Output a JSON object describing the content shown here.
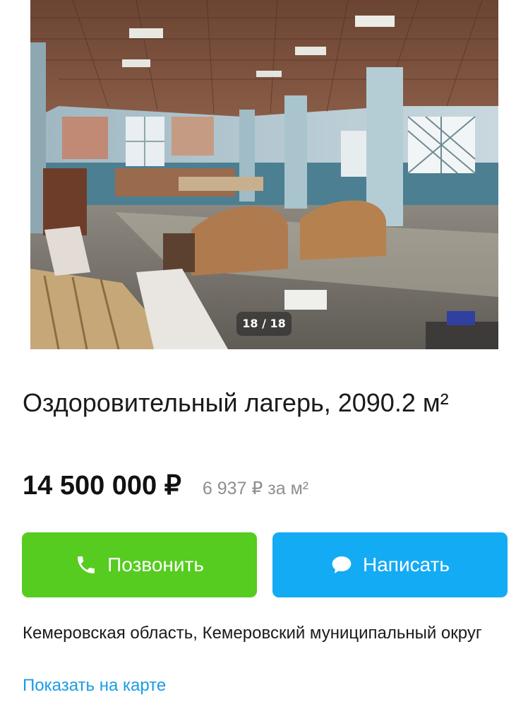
{
  "gallery": {
    "counter": "18 / 18"
  },
  "listing": {
    "title": "Оздоровительный лагерь, 2090.2 м²",
    "price": "14 500 000 ₽",
    "price_per_m2": "6 937 ₽ за м²"
  },
  "actions": {
    "call_label": "Позвонить",
    "write_label": "Написать",
    "call_color": "#55cc1f",
    "write_color": "#14abf5"
  },
  "location": {
    "address": "Кемеровская область, Кемеровский муниципальный округ",
    "map_link": "Показать на карте"
  }
}
